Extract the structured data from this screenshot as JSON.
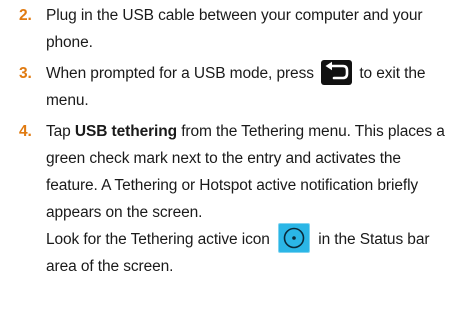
{
  "steps": [
    {
      "number": "2.",
      "lines": [
        "Plug in the USB cable between your computer and your",
        "phone."
      ]
    },
    {
      "number": "3.",
      "line1_before": "When prompted for a USB mode, press",
      "line1_after": "to exit the",
      "line2": "menu.",
      "icon": "back-arrow-icon"
    },
    {
      "number": "4.",
      "tap": "Tap",
      "bold_term": "USB tethering",
      "line1_rest": "from the Tethering menu. This places a",
      "line2": "green check mark next to the entry and activates the",
      "line3": "feature. A Tethering or Hotspot active notification briefly",
      "line4": "appears on the screen.",
      "line5_before": "Look for the Tethering active icon",
      "line5_after": "in the Status bar",
      "line6": "area of the screen.",
      "icon": "tethering-active-icon"
    }
  ],
  "colors": {
    "step_number": "#e07a10",
    "tether_icon_bg": "#2bb6e6",
    "back_icon_bg": "#111111"
  }
}
